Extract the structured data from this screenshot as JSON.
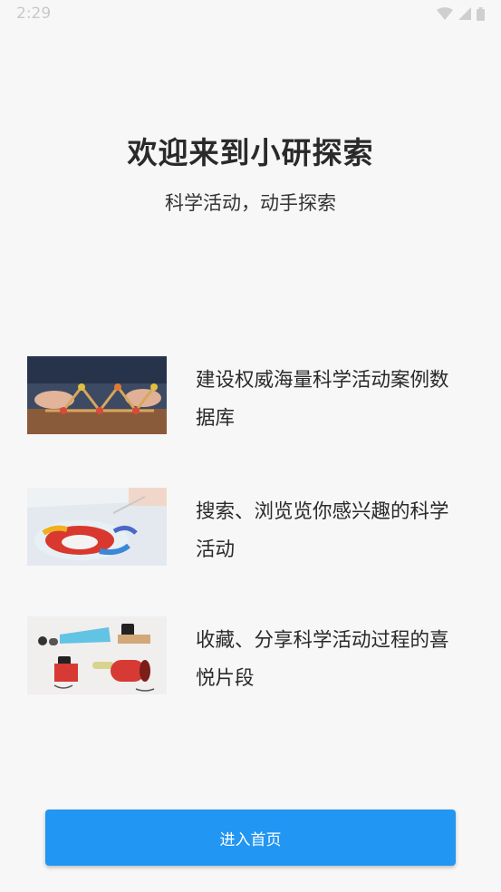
{
  "status_bar": {
    "time": "2:29",
    "wifi_icon": "wifi-icon",
    "signal_icon": "signal-icon",
    "battery_icon": "battery-icon"
  },
  "header": {
    "title": "欢迎来到小研探索",
    "subtitle": "科学活动，动手探索"
  },
  "features": [
    {
      "image": "activity-photo-building",
      "text": "建设权威海量科学活动案例数据库"
    },
    {
      "image": "activity-photo-color-water",
      "text": "搜索、浏览览你感兴趣的科学活动"
    },
    {
      "image": "activity-photo-sound-tubes",
      "text": "收藏、分享科学活动过程的喜悦片段"
    }
  ],
  "enter_button": {
    "label": "进入首页"
  },
  "colors": {
    "accent": "#2196f3",
    "background": "#f7f7f8"
  }
}
